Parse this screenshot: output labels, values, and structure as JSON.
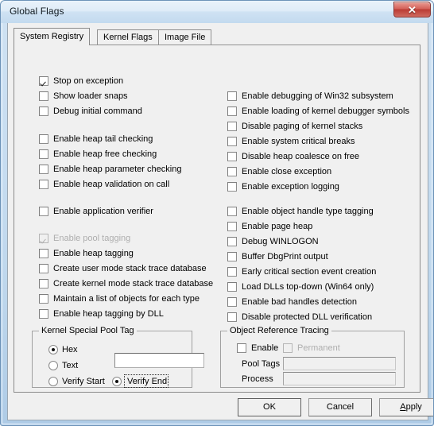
{
  "window": {
    "title": "Global Flags",
    "close_glyph": "✕"
  },
  "tabs": [
    {
      "label": "System Registry",
      "selected": true
    },
    {
      "label": "Kernel Flags",
      "selected": false
    },
    {
      "label": "Image File",
      "selected": false
    }
  ],
  "left_column": {
    "group1": [
      {
        "label": "Stop on exception",
        "checked": true,
        "disabled": false
      },
      {
        "label": "Show loader snaps",
        "checked": false,
        "disabled": false
      },
      {
        "label": "Debug initial command",
        "checked": false,
        "disabled": false
      }
    ],
    "group2": [
      {
        "label": "Enable heap tail checking",
        "checked": false,
        "disabled": false
      },
      {
        "label": "Enable heap free checking",
        "checked": false,
        "disabled": false
      },
      {
        "label": "Enable heap parameter checking",
        "checked": false,
        "disabled": false
      },
      {
        "label": "Enable heap validation on call",
        "checked": false,
        "disabled": false
      }
    ],
    "group3": [
      {
        "label": "Enable application verifier",
        "checked": false,
        "disabled": false
      }
    ],
    "group4": [
      {
        "label": "Enable pool tagging",
        "checked": true,
        "disabled": true
      },
      {
        "label": "Enable heap tagging",
        "checked": false,
        "disabled": false
      },
      {
        "label": "Create user mode stack trace database",
        "checked": false,
        "disabled": false
      },
      {
        "label": "Create kernel mode stack trace database",
        "checked": false,
        "disabled": false
      },
      {
        "label": "Maintain a list of objects for each type",
        "checked": false,
        "disabled": false
      },
      {
        "label": "Enable heap tagging by DLL",
        "checked": false,
        "disabled": false
      }
    ]
  },
  "right_column": {
    "group1": [
      {
        "label": "Enable debugging of Win32 subsystem",
        "checked": false,
        "disabled": false
      },
      {
        "label": "Enable loading of kernel debugger symbols",
        "checked": false,
        "disabled": false
      },
      {
        "label": "Disable paging of kernel stacks",
        "checked": false,
        "disabled": false
      },
      {
        "label": "Enable system critical breaks",
        "checked": false,
        "disabled": false
      },
      {
        "label": "Disable heap coalesce on free",
        "checked": false,
        "disabled": false
      },
      {
        "label": "Enable close exception",
        "checked": false,
        "disabled": false
      },
      {
        "label": "Enable exception logging",
        "checked": false,
        "disabled": false
      }
    ],
    "group2": [
      {
        "label": "Enable object handle type tagging",
        "checked": false,
        "disabled": false
      },
      {
        "label": "Enable page heap",
        "checked": false,
        "disabled": false
      },
      {
        "label": "Debug WINLOGON",
        "checked": false,
        "disabled": false
      },
      {
        "label": "Buffer DbgPrint output",
        "checked": false,
        "disabled": false
      },
      {
        "label": "Early critical section event creation",
        "checked": false,
        "disabled": false
      },
      {
        "label": "Load DLLs top-down (Win64 only)",
        "checked": false,
        "disabled": false
      },
      {
        "label": "Enable bad handles detection",
        "checked": false,
        "disabled": false
      },
      {
        "label": "Disable protected DLL verification",
        "checked": false,
        "disabled": false
      }
    ]
  },
  "kernel_special_pool_tag": {
    "caption": "Kernel Special Pool Tag",
    "radios_format": [
      {
        "label": "Hex",
        "selected": true
      },
      {
        "label": "Text",
        "selected": false
      }
    ],
    "radios_verify": [
      {
        "label": "Verify Start",
        "selected": false,
        "focused": false
      },
      {
        "label": "Verify End",
        "selected": true,
        "focused": true
      }
    ],
    "tag_value": "",
    "tag_placeholder": ""
  },
  "object_reference_tracing": {
    "caption": "Object Reference Tracing",
    "enable": {
      "label": "Enable",
      "checked": false,
      "disabled": false
    },
    "permanent": {
      "label": "Permanent",
      "checked": false,
      "disabled": true
    },
    "pool_tags": {
      "label": "Pool Tags",
      "value": "",
      "disabled": true
    },
    "process": {
      "label": "Process",
      "value": "",
      "disabled": true
    }
  },
  "buttons": {
    "ok": "OK",
    "cancel": "Cancel",
    "apply_accel": "A",
    "apply_rest": "pply"
  }
}
